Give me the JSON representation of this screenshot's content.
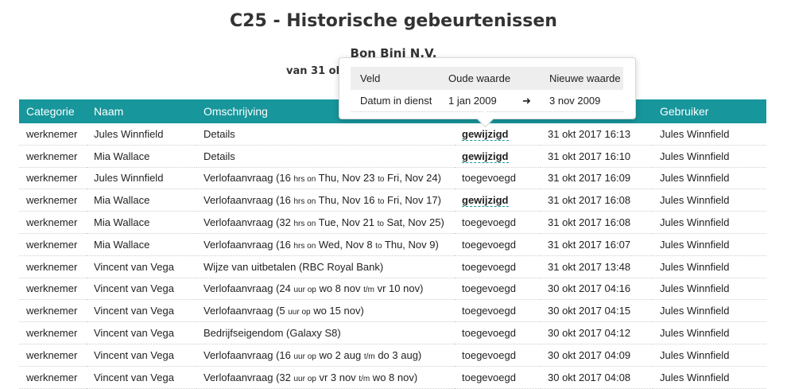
{
  "page": {
    "title": "C25 - Historische gebeurtenissen",
    "company": "Bon Bini N.V.",
    "date_range_visible": "van 31 okt"
  },
  "columns": [
    "Categorie",
    "Naam",
    "Omschrijving",
    "",
    "",
    "Gebruiker"
  ],
  "rows": [
    {
      "cat": "werknemer",
      "name": "Jules Winnfield",
      "desc": [
        {
          "t": "Details"
        }
      ],
      "action": "gewijzigd",
      "changed": true,
      "time": "31 okt 2017 16:13",
      "user": "Jules Winnfield"
    },
    {
      "cat": "werknemer",
      "name": "Mia Wallace",
      "desc": [
        {
          "t": "Details"
        }
      ],
      "action": "gewijzigd",
      "changed": true,
      "time": "31 okt 2017 16:10",
      "user": "Jules Winnfield"
    },
    {
      "cat": "werknemer",
      "name": "Jules Winnfield",
      "desc": [
        {
          "t": "Verlofaanvraag (16 "
        },
        {
          "s": "hrs on"
        },
        {
          "t": " Thu, Nov 23 "
        },
        {
          "s": "to"
        },
        {
          "t": " Fri, Nov 24)"
        }
      ],
      "action": "toegevoegd",
      "changed": false,
      "time": "31 okt 2017 16:09",
      "user": "Jules Winnfield"
    },
    {
      "cat": "werknemer",
      "name": "Mia Wallace",
      "desc": [
        {
          "t": "Verlofaanvraag (16 "
        },
        {
          "s": "hrs on"
        },
        {
          "t": " Thu, Nov 16 "
        },
        {
          "s": "to"
        },
        {
          "t": " Fri, Nov 17)"
        }
      ],
      "action": "gewijzigd",
      "changed": true,
      "time": "31 okt 2017 16:08",
      "user": "Jules Winnfield"
    },
    {
      "cat": "werknemer",
      "name": "Mia Wallace",
      "desc": [
        {
          "t": "Verlofaanvraag (32 "
        },
        {
          "s": "hrs on"
        },
        {
          "t": " Tue, Nov 21 "
        },
        {
          "s": "to"
        },
        {
          "t": " Sat, Nov 25)"
        }
      ],
      "action": "toegevoegd",
      "changed": false,
      "time": "31 okt 2017 16:08",
      "user": "Jules Winnfield"
    },
    {
      "cat": "werknemer",
      "name": "Mia Wallace",
      "desc": [
        {
          "t": "Verlofaanvraag (16 "
        },
        {
          "s": "hrs on"
        },
        {
          "t": " Wed, Nov 8 "
        },
        {
          "s": "to"
        },
        {
          "t": " Thu, Nov 9)"
        }
      ],
      "action": "toegevoegd",
      "changed": false,
      "time": "31 okt 2017 16:07",
      "user": "Jules Winnfield"
    },
    {
      "cat": "werknemer",
      "name": "Vincent van Vega",
      "desc": [
        {
          "t": "Wijze van uitbetalen (RBC Royal Bank)"
        }
      ],
      "action": "toegevoegd",
      "changed": false,
      "time": "31 okt 2017 13:48",
      "user": "Jules Winnfield"
    },
    {
      "cat": "werknemer",
      "name": "Vincent van Vega",
      "desc": [
        {
          "t": "Verlofaanvraag (24 "
        },
        {
          "s": "uur op"
        },
        {
          "t": " wo 8 nov "
        },
        {
          "s": "t/m"
        },
        {
          "t": " vr 10 nov)"
        }
      ],
      "action": "toegevoegd",
      "changed": false,
      "time": "30 okt 2017 04:16",
      "user": "Jules Winnfield"
    },
    {
      "cat": "werknemer",
      "name": "Vincent van Vega",
      "desc": [
        {
          "t": "Verlofaanvraag (5 "
        },
        {
          "s": "uur op"
        },
        {
          "t": " wo 15 nov)"
        }
      ],
      "action": "toegevoegd",
      "changed": false,
      "time": "30 okt 2017 04:15",
      "user": "Jules Winnfield"
    },
    {
      "cat": "werknemer",
      "name": "Vincent van Vega",
      "desc": [
        {
          "t": "Bedrijfseigendom (Galaxy S8)"
        }
      ],
      "action": "toegevoegd",
      "changed": false,
      "time": "30 okt 2017 04:12",
      "user": "Jules Winnfield"
    },
    {
      "cat": "werknemer",
      "name": "Vincent van Vega",
      "desc": [
        {
          "t": "Verlofaanvraag (16 "
        },
        {
          "s": "uur op"
        },
        {
          "t": " wo 2 aug "
        },
        {
          "s": "t/m"
        },
        {
          "t": " do 3 aug)"
        }
      ],
      "action": "toegevoegd",
      "changed": false,
      "time": "30 okt 2017 04:09",
      "user": "Jules Winnfield"
    },
    {
      "cat": "werknemer",
      "name": "Vincent van Vega",
      "desc": [
        {
          "t": "Verlofaanvraag (32 "
        },
        {
          "s": "uur op"
        },
        {
          "t": " vr 3 nov "
        },
        {
          "s": "t/m"
        },
        {
          "t": " wo 8 nov)"
        }
      ],
      "action": "toegevoegd",
      "changed": false,
      "time": "30 okt 2017 04:08",
      "user": "Jules Winnfield"
    }
  ],
  "tooltip": {
    "headers": [
      "Veld",
      "Oude waarde",
      "Nieuwe waarde"
    ],
    "row": {
      "field": "Datum in dienst",
      "old": "1 jan 2009",
      "arrow": "➜",
      "new": "3 nov 2009"
    }
  },
  "colors": {
    "header_bg": "#17969b",
    "header_text": "#ffffff"
  }
}
